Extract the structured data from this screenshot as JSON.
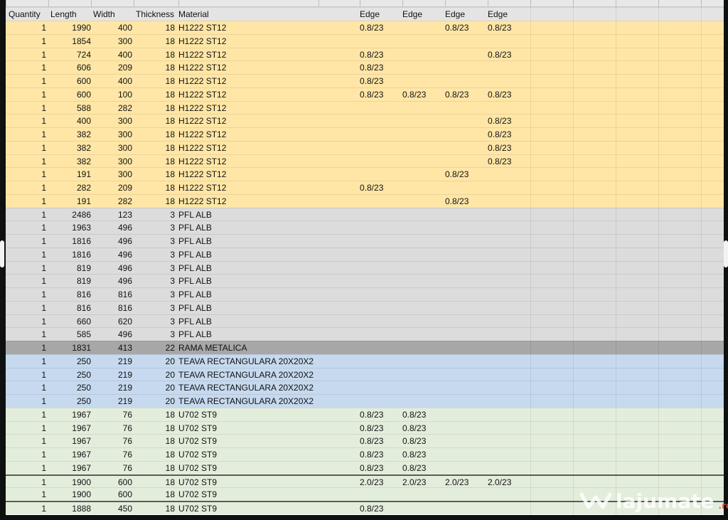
{
  "headers": [
    "Quantity",
    "Length",
    "Width",
    "Thickness",
    "Material",
    "Edge",
    "Edge",
    "Edge",
    "Edge"
  ],
  "rows": [
    {
      "color": "yellow",
      "cells": [
        "1",
        "1990",
        "400",
        "18",
        "H1222 ST12",
        "0.8/23",
        "",
        "0.8/23",
        "0.8/23"
      ]
    },
    {
      "color": "yellow",
      "cells": [
        "1",
        "1854",
        "300",
        "18",
        "H1222 ST12",
        "",
        "",
        "",
        ""
      ]
    },
    {
      "color": "yellow",
      "cells": [
        "1",
        "724",
        "400",
        "18",
        "H1222 ST12",
        "0.8/23",
        "",
        "",
        "0.8/23"
      ]
    },
    {
      "color": "yellow",
      "cells": [
        "1",
        "606",
        "209",
        "18",
        "H1222 ST12",
        "0.8/23",
        "",
        "",
        ""
      ]
    },
    {
      "color": "yellow",
      "cells": [
        "1",
        "600",
        "400",
        "18",
        "H1222 ST12",
        "0.8/23",
        "",
        "",
        ""
      ]
    },
    {
      "color": "yellow",
      "cells": [
        "1",
        "600",
        "100",
        "18",
        "H1222 ST12",
        "0.8/23",
        "0.8/23",
        "0.8/23",
        "0.8/23"
      ]
    },
    {
      "color": "yellow",
      "cells": [
        "1",
        "588",
        "282",
        "18",
        "H1222 ST12",
        "",
        "",
        "",
        ""
      ]
    },
    {
      "color": "yellow",
      "cells": [
        "1",
        "400",
        "300",
        "18",
        "H1222 ST12",
        "",
        "",
        "",
        "0.8/23"
      ]
    },
    {
      "color": "yellow",
      "cells": [
        "1",
        "382",
        "300",
        "18",
        "H1222 ST12",
        "",
        "",
        "",
        "0.8/23"
      ]
    },
    {
      "color": "yellow",
      "cells": [
        "1",
        "382",
        "300",
        "18",
        "H1222 ST12",
        "",
        "",
        "",
        "0.8/23"
      ]
    },
    {
      "color": "yellow",
      "cells": [
        "1",
        "382",
        "300",
        "18",
        "H1222 ST12",
        "",
        "",
        "",
        "0.8/23"
      ]
    },
    {
      "color": "yellow",
      "cells": [
        "1",
        "191",
        "300",
        "18",
        "H1222 ST12",
        "",
        "",
        "0.8/23",
        ""
      ]
    },
    {
      "color": "yellow",
      "cells": [
        "1",
        "282",
        "209",
        "18",
        "H1222 ST12",
        "0.8/23",
        "",
        "",
        ""
      ]
    },
    {
      "color": "yellow",
      "cells": [
        "1",
        "191",
        "282",
        "18",
        "H1222 ST12",
        "",
        "",
        "0.8/23",
        ""
      ]
    },
    {
      "color": "grey",
      "cells": [
        "1",
        "2486",
        "123",
        "3",
        "PFL ALB",
        "",
        "",
        "",
        ""
      ]
    },
    {
      "color": "grey",
      "cells": [
        "1",
        "1963",
        "496",
        "3",
        "PFL ALB",
        "",
        "",
        "",
        ""
      ]
    },
    {
      "color": "grey",
      "cells": [
        "1",
        "1816",
        "496",
        "3",
        "PFL ALB",
        "",
        "",
        "",
        ""
      ]
    },
    {
      "color": "grey",
      "cells": [
        "1",
        "1816",
        "496",
        "3",
        "PFL ALB",
        "",
        "",
        "",
        ""
      ]
    },
    {
      "color": "grey",
      "cells": [
        "1",
        "819",
        "496",
        "3",
        "PFL ALB",
        "",
        "",
        "",
        ""
      ]
    },
    {
      "color": "grey",
      "cells": [
        "1",
        "819",
        "496",
        "3",
        "PFL ALB",
        "",
        "",
        "",
        ""
      ]
    },
    {
      "color": "grey",
      "cells": [
        "1",
        "816",
        "816",
        "3",
        "PFL ALB",
        "",
        "",
        "",
        ""
      ]
    },
    {
      "color": "grey",
      "cells": [
        "1",
        "816",
        "816",
        "3",
        "PFL ALB",
        "",
        "",
        "",
        ""
      ]
    },
    {
      "color": "grey",
      "cells": [
        "1",
        "660",
        "620",
        "3",
        "PFL ALB",
        "",
        "",
        "",
        ""
      ]
    },
    {
      "color": "grey",
      "cells": [
        "1",
        "585",
        "496",
        "3",
        "PFL ALB",
        "",
        "",
        "",
        ""
      ]
    },
    {
      "color": "dark",
      "cells": [
        "1",
        "1831",
        "413",
        "22",
        "RAMA METALICA",
        "",
        "",
        "",
        ""
      ]
    },
    {
      "color": "blue",
      "cells": [
        "1",
        "250",
        "219",
        "20",
        "TEAVA RECTANGULARA 20X20X2",
        "",
        "",
        "",
        ""
      ]
    },
    {
      "color": "blue",
      "cells": [
        "1",
        "250",
        "219",
        "20",
        "TEAVA RECTANGULARA 20X20X2",
        "",
        "",
        "",
        ""
      ]
    },
    {
      "color": "blue",
      "cells": [
        "1",
        "250",
        "219",
        "20",
        "TEAVA RECTANGULARA 20X20X2",
        "",
        "",
        "",
        ""
      ]
    },
    {
      "color": "blue",
      "cells": [
        "1",
        "250",
        "219",
        "20",
        "TEAVA RECTANGULARA 20X20X2",
        "",
        "",
        "",
        ""
      ]
    },
    {
      "color": "green",
      "cells": [
        "1",
        "1967",
        "76",
        "18",
        "U702 ST9",
        "0.8/23",
        "0.8/23",
        "",
        ""
      ]
    },
    {
      "color": "green",
      "cells": [
        "1",
        "1967",
        "76",
        "18",
        "U702 ST9",
        "0.8/23",
        "0.8/23",
        "",
        ""
      ]
    },
    {
      "color": "green",
      "cells": [
        "1",
        "1967",
        "76",
        "18",
        "U702 ST9",
        "0.8/23",
        "0.8/23",
        "",
        ""
      ]
    },
    {
      "color": "green",
      "cells": [
        "1",
        "1967",
        "76",
        "18",
        "U702 ST9",
        "0.8/23",
        "0.8/23",
        "",
        ""
      ]
    },
    {
      "color": "green",
      "cells": [
        "1",
        "1967",
        "76",
        "18",
        "U702 ST9",
        "0.8/23",
        "0.8/23",
        "",
        ""
      ]
    },
    {
      "color": "green",
      "strong": true,
      "cells": [
        "1",
        "1900",
        "600",
        "18",
        "U702 ST9",
        "2.0/23",
        "2.0/23",
        "2.0/23",
        "2.0/23"
      ]
    },
    {
      "color": "green",
      "cells": [
        "1",
        "1900",
        "600",
        "18",
        "U702 ST9",
        "",
        "",
        "",
        ""
      ]
    },
    {
      "color": "green",
      "strong": true,
      "cells": [
        "1",
        "1888",
        "450",
        "18",
        "U702 ST9",
        "0.8/23",
        "",
        "",
        ""
      ]
    }
  ],
  "watermark": {
    "name": "lajumate",
    "suffix": ".ro",
    "icon": "lajumate-logo-icon"
  },
  "colors": {
    "yellow": "#ffe6a6",
    "grey": "#dcdcdc",
    "dark": "#a7a7a7",
    "blue": "#c6d9ee",
    "green": "#e3eddc"
  }
}
